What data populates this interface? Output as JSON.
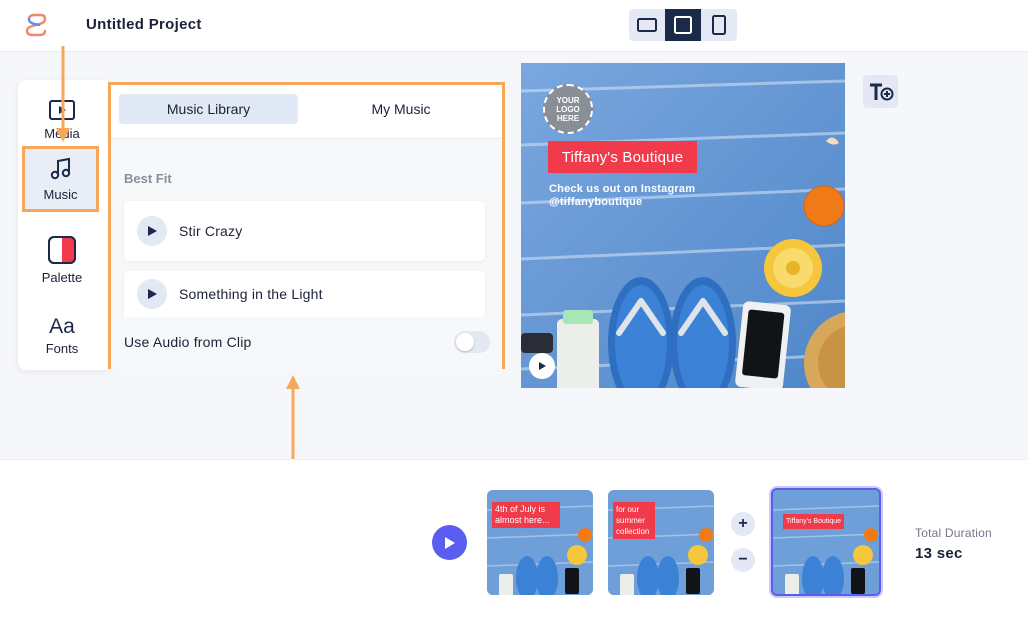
{
  "app": {
    "project_title": "Untitled Project",
    "aspect_ratios": [
      {
        "name": "landscape",
        "active": false
      },
      {
        "name": "square",
        "active": true
      },
      {
        "name": "portrait",
        "active": false
      }
    ],
    "text_tool_label": "T+"
  },
  "sidebar": {
    "items": [
      {
        "label": "Media",
        "icon": "media-icon",
        "selected": false
      },
      {
        "label": "Music",
        "icon": "music-note-icon",
        "selected": true
      },
      {
        "label": "Palette",
        "icon": "palette-icon",
        "selected": false
      },
      {
        "label": "Fonts",
        "icon": "fonts-icon",
        "glyph": "Aa",
        "selected": false
      }
    ]
  },
  "music_panel": {
    "tabs": [
      {
        "label": "Music Library",
        "active": true
      },
      {
        "label": "My Music",
        "active": false
      }
    ],
    "section_title": "Best Fit",
    "tracks": [
      {
        "name": "Stir Crazy"
      },
      {
        "name": "Something in the Light"
      }
    ],
    "use_audio_label": "Use Audio from Clip",
    "use_audio_enabled": false
  },
  "preview": {
    "logo_text": "YOUR LOGO HERE",
    "brand_name": "Tiffany's Boutique",
    "promo_line1": "Check us out on Instagram",
    "promo_line2": "@tiffanyboutique"
  },
  "timeline": {
    "clips": [
      {
        "label": "4th of July is almost here...",
        "selected": false
      },
      {
        "label": "for our summer collection",
        "selected": false
      },
      {
        "label": "Tiffany's Boutique",
        "selected": true
      }
    ],
    "zoom_in": "+",
    "zoom_out": "−",
    "duration_label": "Total Duration",
    "duration_value": "13 sec"
  },
  "colors": {
    "accent": "#5b5cf0",
    "highlight": "#f5a85a",
    "brand_red": "#f23b4a",
    "navy": "#1c2a4a"
  }
}
